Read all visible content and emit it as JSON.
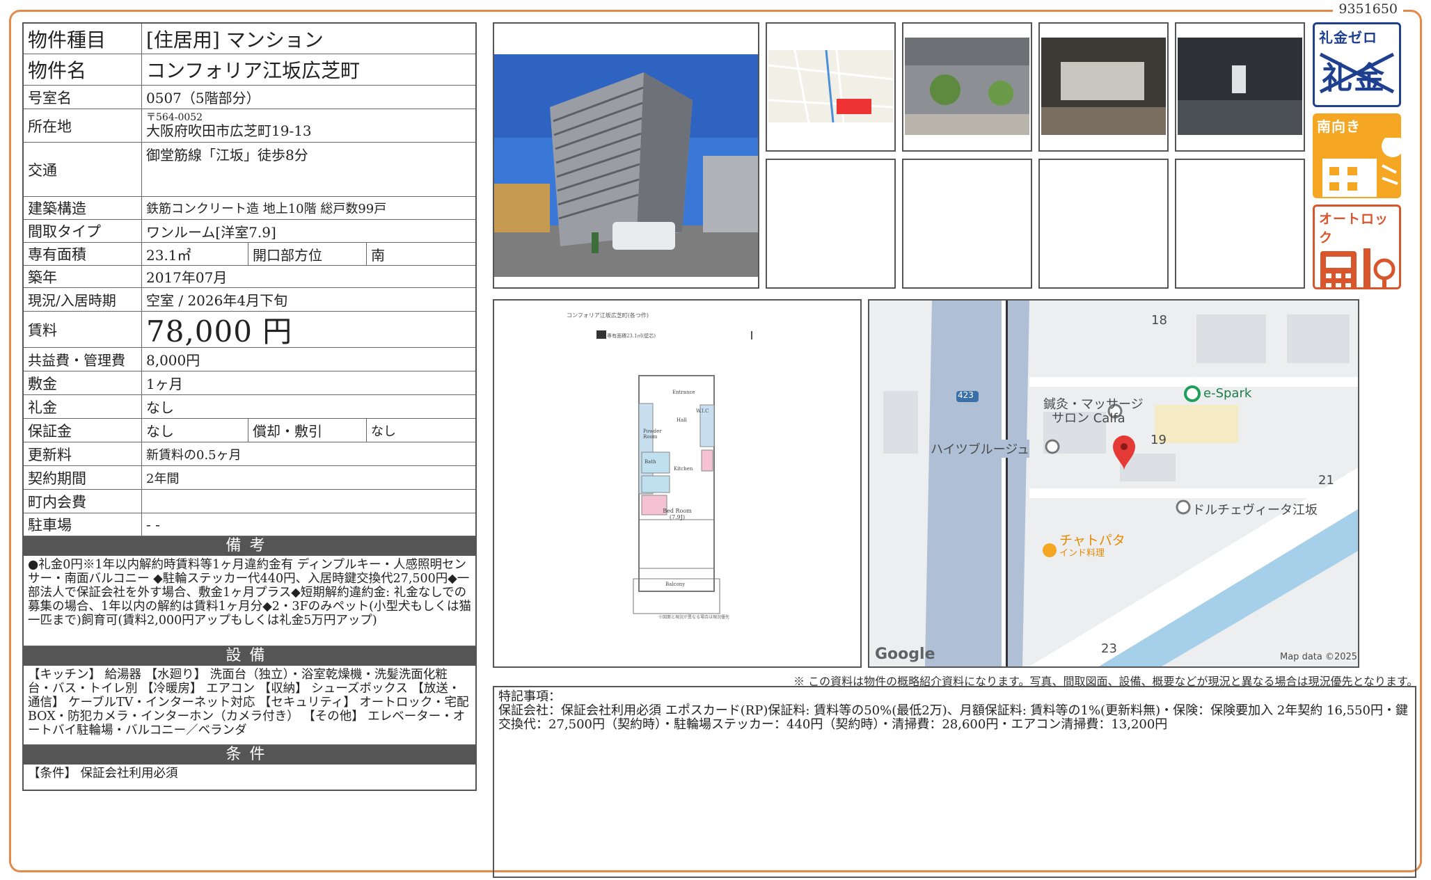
{
  "doc_id": "9351650",
  "info": {
    "type_label": "物件種目",
    "type_value": "[住居用] マンション",
    "name_label": "物件名",
    "name_value": "コンフォリア江坂広芝町",
    "room_label": "号室名",
    "room_value": "0507（5階部分）",
    "location_label": "所在地",
    "zip": "〒564-0052",
    "address": "大阪府吹田市広芝町19-13",
    "traffic_label": "交通",
    "traffic_value": "御堂筋線「江坂」徒歩8分",
    "structure_label": "建築構造",
    "structure_value": "鉄筋コンクリート造 地上10階 総戸数99戸",
    "layout_label": "間取タイプ",
    "layout_value": "ワンルーム[洋室7.9]",
    "area_label": "専有面積",
    "area_value": "23.1㎡",
    "direction_label": "開口部方位",
    "direction_value": "南",
    "built_label": "築年",
    "built_value": "2017年07月",
    "status_label": "現況/入居時期",
    "status_value": "空室 / 2026年4月下旬",
    "rent_label": "賃料",
    "rent_value": "78,000 円",
    "fee_label": "共益費・管理費",
    "fee_value": "8,000円",
    "deposit_label": "敷金",
    "deposit_value": "1ヶ月",
    "key_money_label": "礼金",
    "key_money_value": "なし",
    "guarantee_label": "保証金",
    "guarantee_value": "なし",
    "amort_label": "償却・敷引",
    "amort_value": "なし",
    "renewal_label": "更新料",
    "renewal_value": "新賃料の0.5ヶ月",
    "contract_label": "契約期間",
    "contract_value": "2年間",
    "town_fee_label": "町内会費",
    "town_fee_value": "",
    "parking_label": "駐車場",
    "parking_value": "- -"
  },
  "notes_head": "備考",
  "notes": "●礼金0円※1年以内解約時賃料等1ヶ月違約金有 ディンプルキー・人感照明センサー・南面バルコニー ◆駐輪ステッカー代440円、入居時鍵交換代27,500円◆一部法人で保証会社を外す場合、敷金1ヶ月プラス◆短期解約違約金: 礼金なしでの募集の場合、1年以内の解約は賃料1ヶ月分◆2・3Fのみペット(小型犬もしくは猫一匹まで)飼育可(賃料2,000円アップもしくは礼金5万円アップ)",
  "equip_head": "設備",
  "equip": "【キッチン】 給湯器 【水廻り】 洗面台（独立）・浴室乾燥機・洗髪洗面化粧台・バス・トイレ別 【冷暖房】 エアコン 【収納】 シューズボックス 【放送・通信】 ケーブルTV・インターネット対応 【セキュリティ】 オートロック・宅配BOX・防犯カメラ・インターホン（カメラ付き） 【その他】 エレベーター・オートバイ駐輪場・バルコニー／ベランダ",
  "cond_head": "条件",
  "cond": "【条件】 保証会社利用必須",
  "badges": {
    "reikin_top": "礼金ゼロ",
    "reikin_mark": "礼金",
    "south": "南向き",
    "autolock": "オートロック"
  },
  "floorplan": {
    "title": "コンフォリア江坂広芝町(各つ作)",
    "sub": "1R 専有面積23.1㎡(壁芯)",
    "rooms": [
      "Entrance",
      "W.I.C",
      "Hall",
      "Kitchen",
      "Bath",
      "Powder Room",
      "Bed Room (7.9J)",
      "Balcony"
    ],
    "note": "※図面と現況が異なる場合は現況優先"
  },
  "map": {
    "labels": [
      "18",
      "19",
      "21",
      "23",
      "423",
      "e-Spark",
      "鍼灸・マッサージ",
      "サロン Calfa",
      "ハイツブルージュ",
      "ドルチェヴィータ江坂",
      "チャトパタ",
      "インド料理",
      "Google",
      "Map data ©2025"
    ]
  },
  "notice": "※ この資料は物件の概略紹介資料になります。写真、間取図面、設備、概要などが現況と異なる場合は現況優先となります。",
  "remarks_title": "特記事項：",
  "remarks": "保証会社：保証会社利用必須 エポスカード(RP)保証料: 賃料等の50%(最低2万)、月額保証料: 賃料等の1%(更新料無)・保険：保険要加入 2年契約 16,550円・鍵交換代：27,500円（契約時）・駐輪場ステッカー：440円（契約時）・清掃費：28,600円・エアコン清掃費：13,200円",
  "colors": {
    "frame": "#e3894a",
    "section_head": "#555555",
    "badge_orange": "#f5a623",
    "badge_red": "#d9552b",
    "badge_navy": "#1f3f8f"
  }
}
